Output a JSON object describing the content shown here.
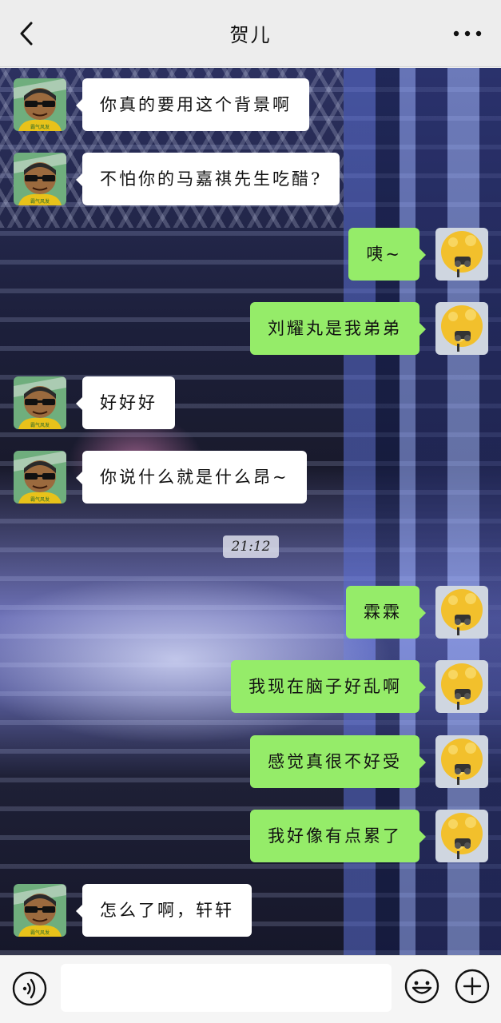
{
  "header": {
    "title": "贺儿",
    "back_icon": "chevron-left-icon",
    "more_icon": "more-dots-icon"
  },
  "chat": {
    "messages": [
      {
        "side": "in",
        "text": "你真的要用这个背景啊"
      },
      {
        "side": "in",
        "text": "不怕你的马嘉祺先生吃醋?"
      },
      {
        "side": "out",
        "text": "咦~"
      },
      {
        "side": "out",
        "text": "刘耀丸是我弟弟"
      },
      {
        "side": "in",
        "text": "好好好"
      },
      {
        "side": "in",
        "text": "你说什么就是什么昂~"
      },
      {
        "side": "out",
        "text": "霖霖"
      },
      {
        "side": "out",
        "text": "我现在脑子好乱啊"
      },
      {
        "side": "out",
        "text": "感觉真很不好受"
      },
      {
        "side": "out",
        "text": "我好像有点累了"
      },
      {
        "side": "in",
        "text": "怎么了啊，轩轩"
      }
    ],
    "timestamp": "21:12",
    "avatar_caption": "霸气风发"
  },
  "input_bar": {
    "voice_icon": "voice-icon",
    "input_value": "",
    "emoji_icon": "emoji-icon",
    "plus_icon": "plus-icon"
  }
}
